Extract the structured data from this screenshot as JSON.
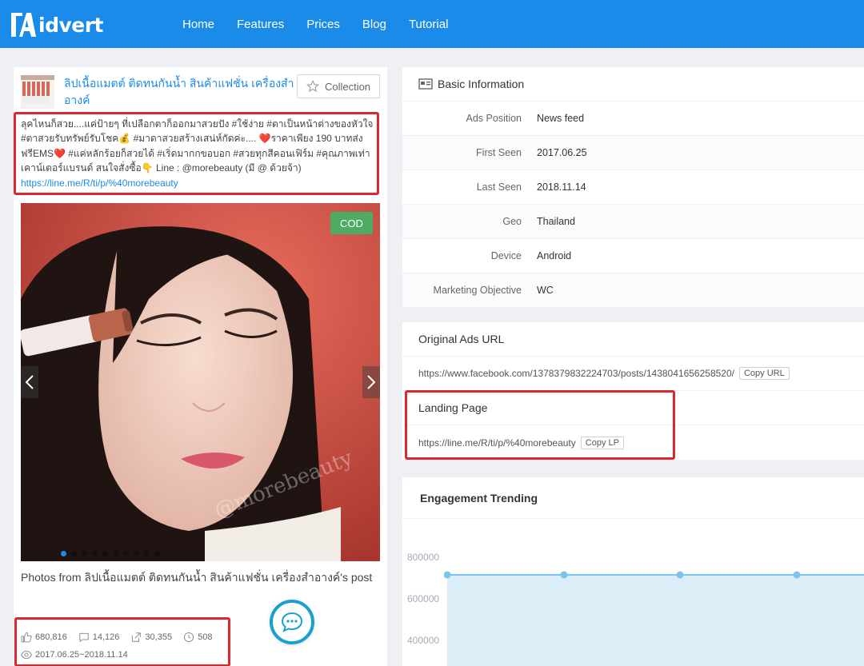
{
  "brand": {
    "name": "idvert"
  },
  "nav": [
    "Home",
    "Features",
    "Prices",
    "Blog",
    "Tutorial"
  ],
  "ad": {
    "title": "ลิปเนื้อแมตต์ ติดทนกันน้ำ สินค้าแฟชั่น เครื่องสำอางค์",
    "collection_label": "Collection",
    "text": "ลุคไหนก็สวย....แค่ป้ายๆ ที่เปลือกตาก็ออกมาสวยปัง #ใช้ง่าย #ตาเป็นหน้าต่างของหัวใจ #ตาสวยรับทรัพย์รับโชค💰 #มาดาสวยสร้างเสน่ห์กัดค่ะ.... ❤️ราคาเพียง 190 บาทส่งฟรีEMS❤️ #แค่หลักร้อยก็สวยได้ #เริ่ดมากกขอบอก #สวยทุกสีคอนเฟิร์ม #คุณภาพเท่าเคาน์เตอร์แบรนด์ สนใจสั่งซื้อ👇 Line : @morebeauty (มี @ ด้วยจ้า)",
    "link": "https://line.me/R/ti/p/%40morebeauty",
    "cod_badge": "COD",
    "watermark": "@morebeauty",
    "caption": "Photos from ลิปเนื้อแมตต์ ติดทนกันน้ำ สินค้าแฟชั่น เครื่องสำอางค์'s post",
    "stats": {
      "likes": "680,816",
      "comments": "14,126",
      "shares": "30,355",
      "duration": "508",
      "date_range": "2017.06.25~2018.11.14"
    }
  },
  "basic_info": {
    "title": "Basic Information",
    "rows": [
      {
        "key": "Ads Position",
        "value": "News feed"
      },
      {
        "key": "First Seen",
        "value": "2017.06.25"
      },
      {
        "key": "Last Seen",
        "value": "2018.11.14"
      },
      {
        "key": "Geo",
        "value": "Thailand"
      },
      {
        "key": "Device",
        "value": "Android"
      },
      {
        "key": "Marketing Objective",
        "value": "WC"
      }
    ]
  },
  "original_url": {
    "title": "Original Ads URL",
    "url": "https://www.facebook.com/1378379832224703/posts/1438041656258520/",
    "copy_label": "Copy URL"
  },
  "landing_page": {
    "title": "Landing Page",
    "url": "https://line.me/R/ti/p/%40morebeauty",
    "copy_label": "Copy LP"
  },
  "engagement": {
    "title": "Engagement Trending",
    "y_ticks": [
      "800000",
      "600000",
      "400000"
    ]
  },
  "colors": {
    "brand": "#1a8be8",
    "highlight": "#d9282f",
    "cod": "#4faa63"
  }
}
